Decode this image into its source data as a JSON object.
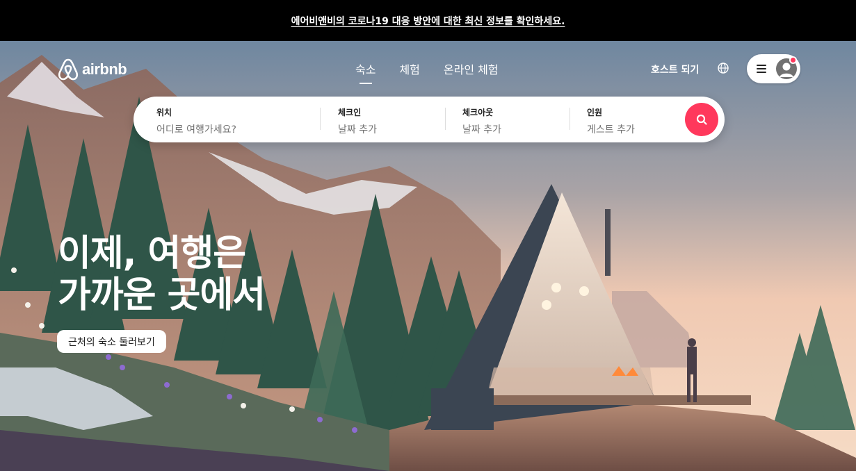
{
  "banner": {
    "text": "에어비앤비의 코로나19 대응 방안에 대한 최신 정보를 확인하세요."
  },
  "header": {
    "logo_text": "airbnb",
    "nav": [
      {
        "label": "숙소",
        "active": true
      },
      {
        "label": "체험",
        "active": false
      },
      {
        "label": "온라인 체험",
        "active": false
      }
    ],
    "host_link": "호스트 되기",
    "globe_icon": "globe-icon",
    "menu_icon": "hamburger-menu-icon",
    "avatar_icon": "user-avatar-icon",
    "has_notification": true
  },
  "search": {
    "location": {
      "label": "위치",
      "placeholder": "어디로 여행가세요?"
    },
    "checkin": {
      "label": "체크인",
      "placeholder": "날짜 추가"
    },
    "checkout": {
      "label": "체크아웃",
      "placeholder": "날짜 추가"
    },
    "guests": {
      "label": "인원",
      "placeholder": "게스트 추가"
    },
    "button_icon": "search-icon"
  },
  "hero": {
    "headline_line1": "이제, 여행은",
    "headline_line2": "가까운 곳에서",
    "explore_button": "근처의 숙소 둘러보기"
  },
  "colors": {
    "brand": "#ff385c",
    "banner_bg": "#000000",
    "text_dark": "#222222",
    "text_muted": "#717171"
  }
}
